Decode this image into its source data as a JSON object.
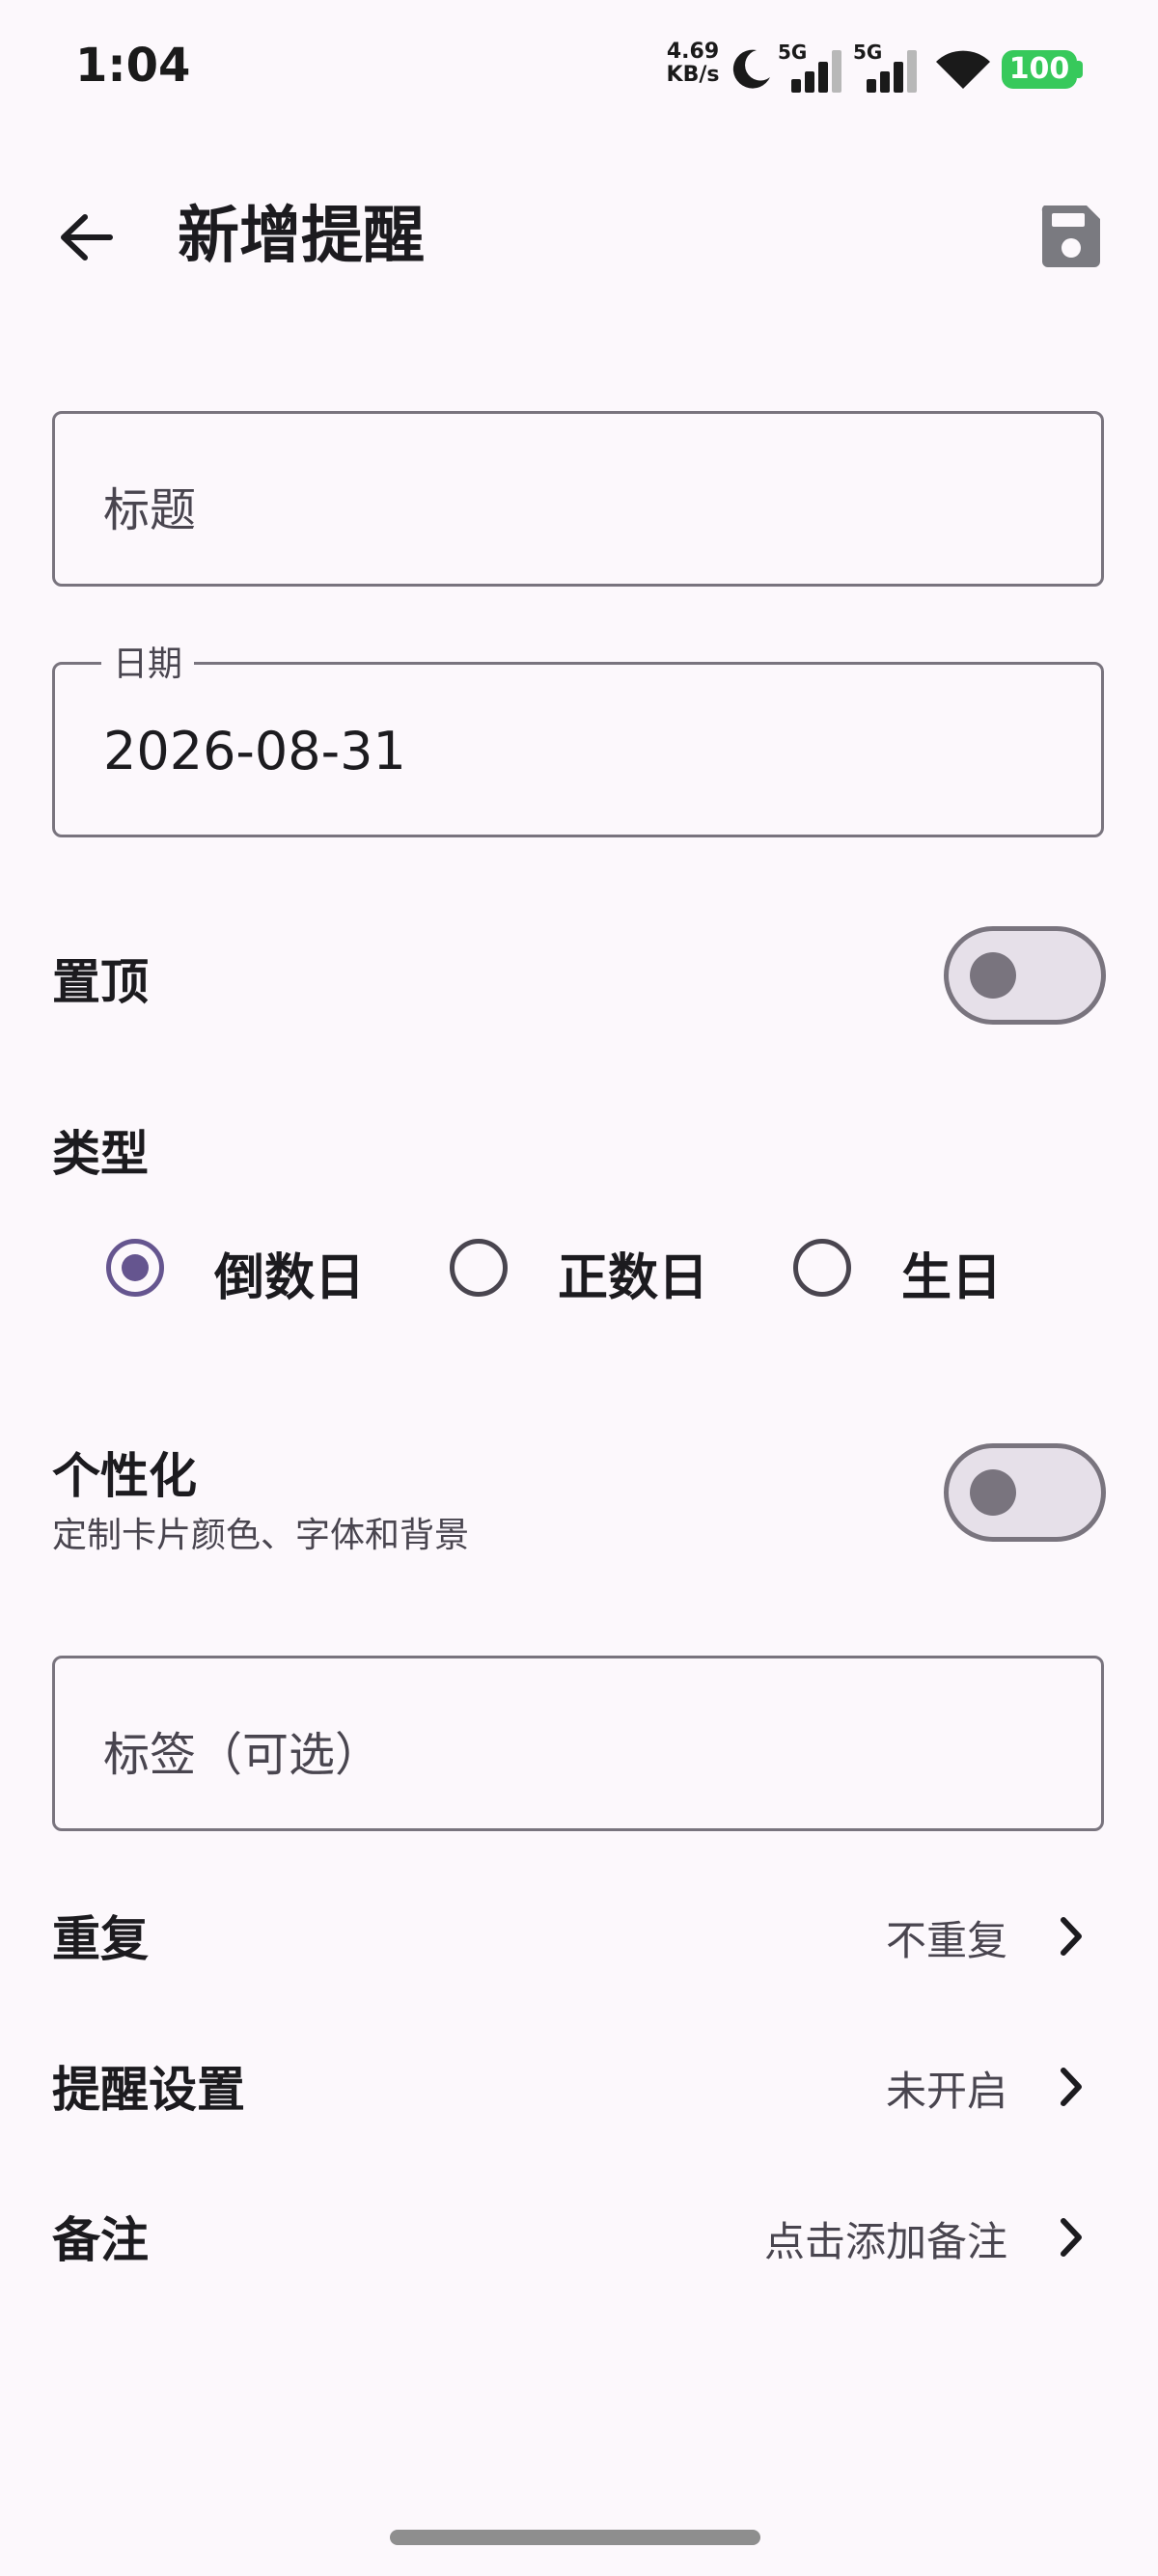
{
  "status_bar": {
    "time": "1:04",
    "net_speed_value": "4.69",
    "net_speed_unit": "KB/s",
    "signal_1_label": "5G",
    "signal_2_label": "5G",
    "battery": "100",
    "icons": [
      "moon-icon",
      "signal-icon",
      "signal-icon",
      "wifi-icon",
      "battery-icon"
    ]
  },
  "app_bar": {
    "title": "新增提醒",
    "back_icon": "arrow-left-icon",
    "save_icon": "save-icon"
  },
  "form": {
    "title_field": {
      "placeholder": "标题",
      "value": ""
    },
    "date_field": {
      "label": "日期",
      "value": "2026-08-31"
    },
    "pin": {
      "label": "置顶",
      "checked": false
    },
    "type": {
      "label": "类型",
      "options": [
        {
          "label": "倒数日",
          "selected": true
        },
        {
          "label": "正数日",
          "selected": false
        },
        {
          "label": "生日",
          "selected": false
        }
      ]
    },
    "personalize": {
      "label": "个性化",
      "subtitle": "定制卡片颜色、字体和背景",
      "checked": false
    },
    "tag_field": {
      "placeholder": "标签（可选）",
      "value": ""
    },
    "repeat": {
      "label": "重复",
      "value": "不重复"
    },
    "reminder": {
      "label": "提醒设置",
      "value": "未开启"
    },
    "note": {
      "label": "备注",
      "value": "点击添加备注"
    }
  },
  "colors": {
    "background": "#fcf8fc",
    "primary": "#65558f",
    "outline": "#79747e",
    "battery": "#37c95b"
  }
}
